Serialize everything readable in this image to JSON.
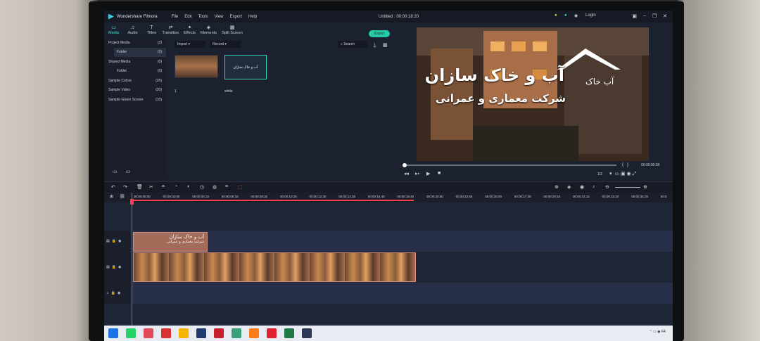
{
  "app": {
    "name": "Wondershare Filmora",
    "document_title": "Untitled : 00:00:18:20",
    "login": "Login"
  },
  "menu": [
    "File",
    "Edit",
    "Tools",
    "View",
    "Export",
    "Help"
  ],
  "tabs": [
    {
      "label": "Media",
      "icon": "folder-icon"
    },
    {
      "label": "Audio",
      "icon": "music-icon"
    },
    {
      "label": "Titles",
      "icon": "text-icon"
    },
    {
      "label": "Transition",
      "icon": "transition-icon"
    },
    {
      "label": "Effects",
      "icon": "effects-icon"
    },
    {
      "label": "Elements",
      "icon": "elements-icon"
    },
    {
      "label": "Split Screen",
      "icon": "split-screen-icon"
    }
  ],
  "export_label": "Export",
  "sidebar": [
    {
      "label": "Project Media",
      "count": "(2)"
    },
    {
      "label": "Folder",
      "count": "(2)"
    },
    {
      "label": "Shared Media",
      "count": "(0)"
    },
    {
      "label": "Folder",
      "count": "(0)"
    },
    {
      "label": "Sample Colors",
      "count": "(25)"
    },
    {
      "label": "Sample Video",
      "count": "(20)"
    },
    {
      "label": "Sample Green Screen",
      "count": "(10)"
    }
  ],
  "media_toolbar": {
    "import": "Import",
    "record": "Record",
    "search_placeholder": "Search"
  },
  "media_items": [
    {
      "label": "1"
    },
    {
      "label": "white"
    }
  ],
  "preview": {
    "line1": "آب و خاک سازان",
    "line2": "شرکت معماری و عمرانی",
    "logo_text": "آب خاک",
    "time": "00:00:00:00",
    "ratio": "1/2"
  },
  "ruler_ticks": [
    "00:00:00:00",
    "00:00:02:05",
    "00:00:04:10",
    "00:00:06:15",
    "00:00:08:20",
    "00:00:10:25",
    "00:00:12:30",
    "00:00:14:35",
    "00:00:16:40",
    "00:00:18:45",
    "00:00:20:50",
    "00:00:22:55",
    "00:00:25:00",
    "00:00:27:05",
    "00:00:29:10",
    "00:00:31:15",
    "00:00:33:20",
    "00:00:35:25",
    "00:0"
  ],
  "title_clip": {
    "line1": "آب و خاک سازان",
    "line2": "شرکت معماری و عمرانی"
  },
  "taskbar_apps": [
    {
      "name": "windows-start-icon",
      "color": "#1a73e8"
    },
    {
      "name": "whatsapp-icon",
      "color": "#25d366"
    },
    {
      "name": "media-player-icon",
      "color": "#e04a5a"
    },
    {
      "name": "acrobat-icon",
      "color": "#d83232"
    },
    {
      "name": "chrome-icon",
      "color": "#f4b400"
    },
    {
      "name": "photoshop-icon",
      "color": "#1f3a6e"
    },
    {
      "name": "autocad-icon",
      "color": "#c8202b"
    },
    {
      "name": "three-icon",
      "color": "#3aa07a"
    },
    {
      "name": "firefox-icon",
      "color": "#ff7b1a"
    },
    {
      "name": "opera-icon",
      "color": "#e0202e"
    },
    {
      "name": "excel-icon",
      "color": "#1d7a45"
    },
    {
      "name": "filmora-icon",
      "color": "#2c3a55"
    }
  ]
}
